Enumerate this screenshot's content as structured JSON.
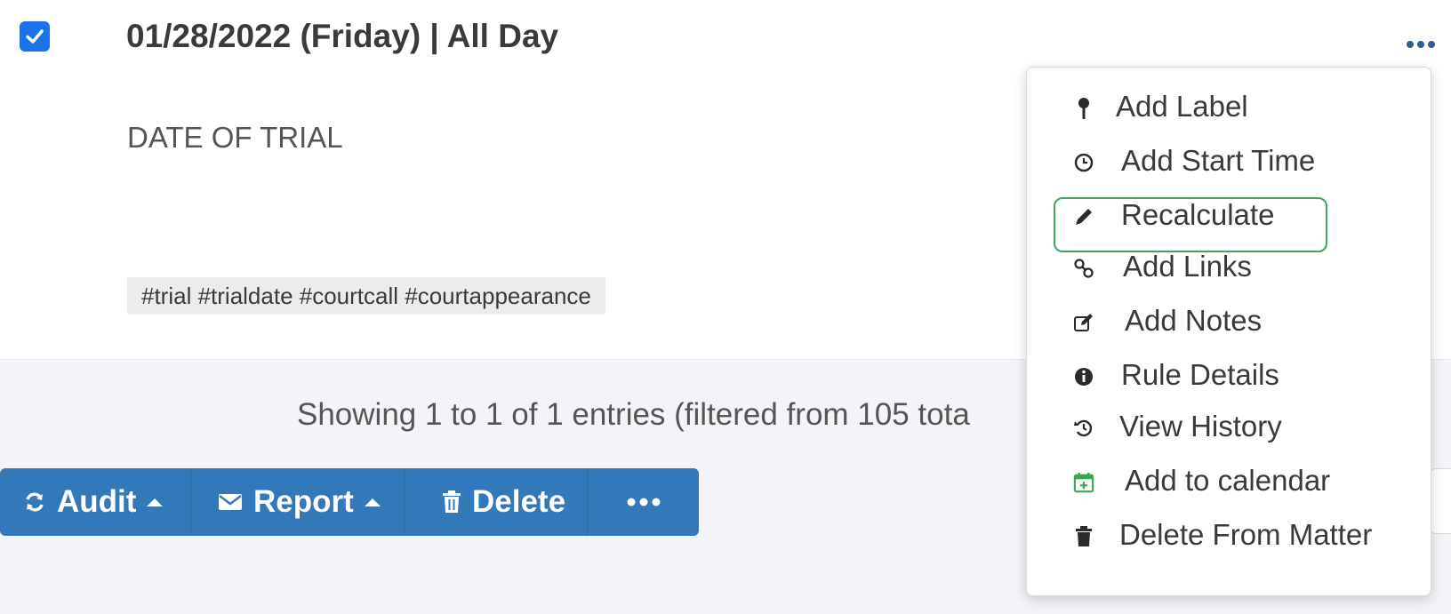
{
  "entry": {
    "checked": true,
    "date_line": "01/28/2022 (Friday)  |  All Day",
    "description": "DATE OF TRIAL",
    "tags": "#trial #trialdate #courtcall #courtappearance"
  },
  "footer": {
    "showing": "Showing 1 to 1 of 1 entries (filtered from 105 tota"
  },
  "toolbar": {
    "audit_label": "Audit",
    "report_label": "Report",
    "delete_label": "Delete",
    "more_label": "•••"
  },
  "menu": {
    "items": [
      {
        "label": "Add Label",
        "icon": "pin-icon"
      },
      {
        "label": "Add Start Time",
        "icon": "clock-icon"
      },
      {
        "label": "Recalculate",
        "icon": "pencil-icon",
        "highlighted": true
      },
      {
        "label": "Add Links",
        "icon": "link-icon"
      },
      {
        "label": "Add Notes",
        "icon": "edit-note-icon"
      },
      {
        "label": "Rule Details",
        "icon": "info-icon"
      },
      {
        "label": "View History",
        "icon": "history-icon"
      },
      {
        "label": "Add to calendar",
        "icon": "calendar-plus-icon"
      },
      {
        "label": "Delete From Matter",
        "icon": "trash-icon"
      }
    ]
  },
  "colors": {
    "primary_button": "#3378b9",
    "checkbox": "#1a73e8",
    "highlight_border": "#3ba55c",
    "calendar_icon": "#3aa655"
  }
}
